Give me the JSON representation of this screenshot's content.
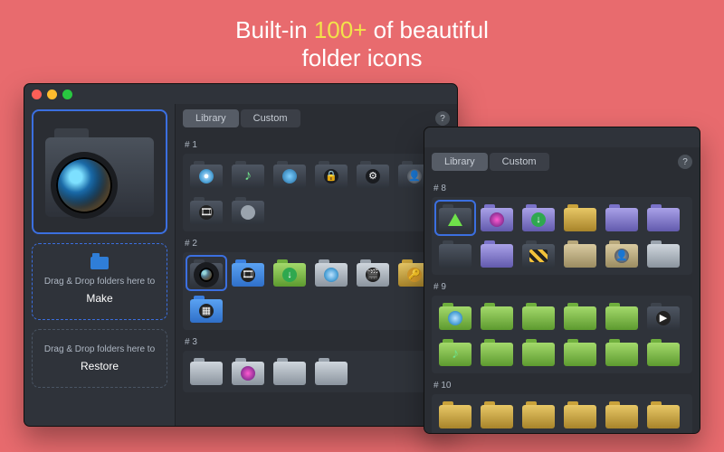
{
  "headline": {
    "pre": "Built-in ",
    "accent": "100+",
    "post": " of beautiful",
    "line2": "folder icons"
  },
  "tabs": {
    "library": "Library",
    "custom": "Custom",
    "help": "?"
  },
  "drop": {
    "lead": "Drag & Drop folders here to",
    "make": "Make",
    "restore": "Restore"
  },
  "w1": {
    "sections": [
      {
        "hdr": "# 1",
        "items": [
          {
            "c": "dark",
            "ov": "disc",
            "g": "●"
          },
          {
            "c": "dark",
            "ov": "note",
            "g": "♪"
          },
          {
            "c": "dark",
            "ov": "globe",
            "g": ""
          },
          {
            "c": "dark",
            "ov": "lock",
            "g": "🔒"
          },
          {
            "c": "dark",
            "ov": "gear",
            "g": "⚙"
          },
          {
            "c": "dark",
            "ov": "user",
            "g": "👤"
          },
          {
            "c": "dark",
            "ov": "film",
            "g": "🎞"
          },
          {
            "c": "dark",
            "ov": "scan",
            "g": ""
          }
        ]
      },
      {
        "hdr": "# 2",
        "items": [
          {
            "c": "dark",
            "sel": true,
            "ov": "lens",
            "g": ""
          },
          {
            "c": "blue",
            "ov": "film",
            "g": "🎞"
          },
          {
            "c": "green",
            "ov": "dl",
            "g": "↓"
          },
          {
            "c": "steel",
            "ov": "disc",
            "g": ""
          },
          {
            "c": "steel",
            "ov": "film",
            "g": "🎬"
          },
          {
            "c": "gold",
            "ov": "key",
            "g": "🔑"
          },
          {
            "c": "blue",
            "ov": "film",
            "g": "▦"
          }
        ]
      },
      {
        "hdr": "# 3",
        "items": [
          {
            "c": "steel"
          },
          {
            "c": "steel",
            "ov": "glow",
            "g": ""
          },
          {
            "c": "steel"
          },
          {
            "c": "steel"
          }
        ]
      }
    ]
  },
  "w2": {
    "sections": [
      {
        "hdr": "# 8",
        "items": [
          {
            "c": "dark",
            "sel": true,
            "ov": "tri",
            "g": ""
          },
          {
            "c": "purple",
            "ov": "glow",
            "g": ""
          },
          {
            "c": "purple",
            "ov": "dl",
            "g": "↓"
          },
          {
            "c": "gold",
            "ov": "",
            "g": "⚠"
          },
          {
            "c": "purple"
          },
          {
            "c": "purple"
          },
          {
            "c": "dark"
          },
          {
            "c": "purple"
          },
          {
            "c": "dark",
            "ov": "caution",
            "g": ""
          },
          {
            "c": "tan"
          },
          {
            "c": "tan",
            "ov": "user",
            "g": "👤"
          },
          {
            "c": "steel"
          }
        ]
      },
      {
        "hdr": "# 9",
        "items": [
          {
            "c": "green",
            "ov": "disc",
            "g": ""
          },
          {
            "c": "green"
          },
          {
            "c": "green"
          },
          {
            "c": "green"
          },
          {
            "c": "green"
          },
          {
            "c": "dark",
            "ov": "film",
            "g": "▶"
          },
          {
            "c": "green",
            "ov": "note",
            "g": "♪"
          },
          {
            "c": "green"
          },
          {
            "c": "green"
          },
          {
            "c": "green"
          },
          {
            "c": "green"
          },
          {
            "c": "green"
          }
        ]
      },
      {
        "hdr": "# 10",
        "items": [
          {
            "c": "gold"
          },
          {
            "c": "gold"
          },
          {
            "c": "gold"
          },
          {
            "c": "gold"
          },
          {
            "c": "gold"
          },
          {
            "c": "gold"
          }
        ]
      }
    ]
  },
  "restore_ghost": "Restore"
}
